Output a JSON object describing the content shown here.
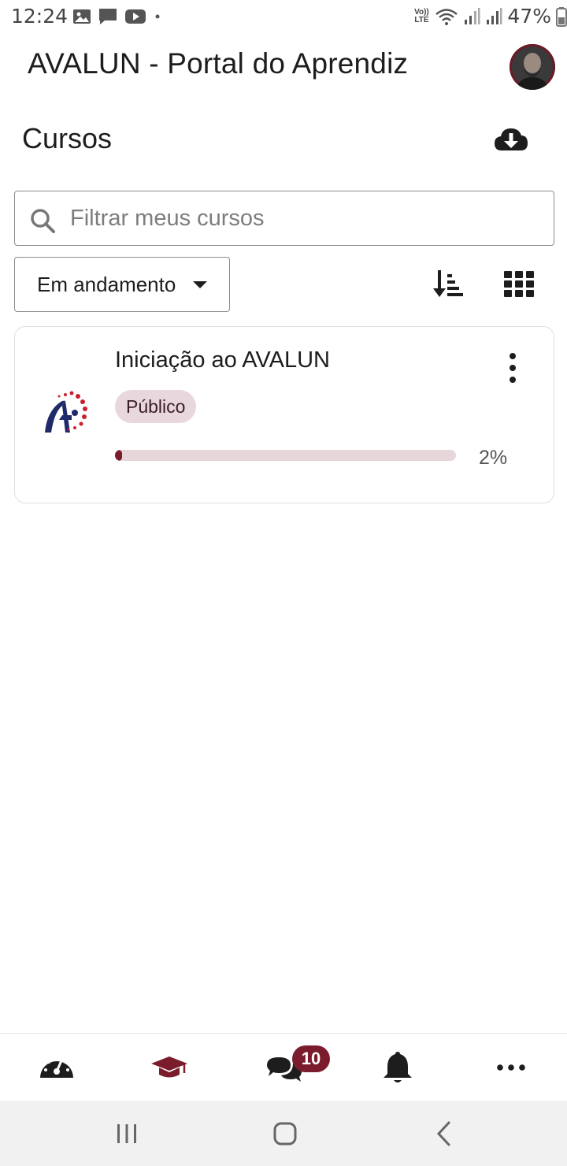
{
  "status_bar": {
    "time": "12:24",
    "battery": "47%",
    "network_top": "Vo))",
    "network_bottom": "LTE",
    "left_icons": [
      "image-icon",
      "message-icon",
      "youtube-icon",
      "dot-icon"
    ],
    "right_icons": [
      "wifi-icon",
      "signal-icon",
      "signal-icon",
      "battery-icon"
    ]
  },
  "header": {
    "title": "AVALUN - Portal do Aprendiz",
    "avatar_icon": "user-avatar"
  },
  "page": {
    "title": "Cursos",
    "download_icon": "cloud-download-icon"
  },
  "search": {
    "placeholder": "Filtrar meus cursos",
    "value": ""
  },
  "filter": {
    "selected": "Em andamento",
    "sort_icon": "sort-icon",
    "view_icon": "grid-view-icon"
  },
  "courses": [
    {
      "title": "Iniciação ao AVALUN",
      "badge": "Público",
      "progress_percent": 2,
      "progress_label": "2%"
    }
  ],
  "tabbar": {
    "items": [
      "dashboard-icon",
      "courses-icon",
      "messages-icon",
      "notifications-icon",
      "more-icon"
    ],
    "messages_badge": "10"
  },
  "colors": {
    "accent": "#7a1c2c",
    "badge_bg": "#e8d7dc",
    "track_bg": "#e6d6da",
    "logo_blue": "#1f2a6b",
    "logo_red": "#c8202e"
  }
}
